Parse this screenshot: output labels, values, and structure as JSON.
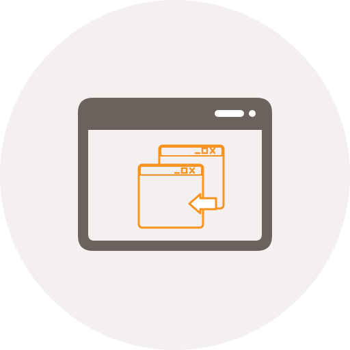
{
  "icon": {
    "name": "window-switch-icon",
    "description_name": "browser-window-with-stacked-windows-and-back-arrow"
  },
  "colors": {
    "background_circle": "#F3F0EF",
    "frame": "#6B625D",
    "accent": "#F7931E",
    "window_fill": "#F3F0EF",
    "light": "#FFFFFF"
  },
  "window_controls": {
    "front_symbols": "_□✕",
    "back_symbols": "_□✕"
  }
}
